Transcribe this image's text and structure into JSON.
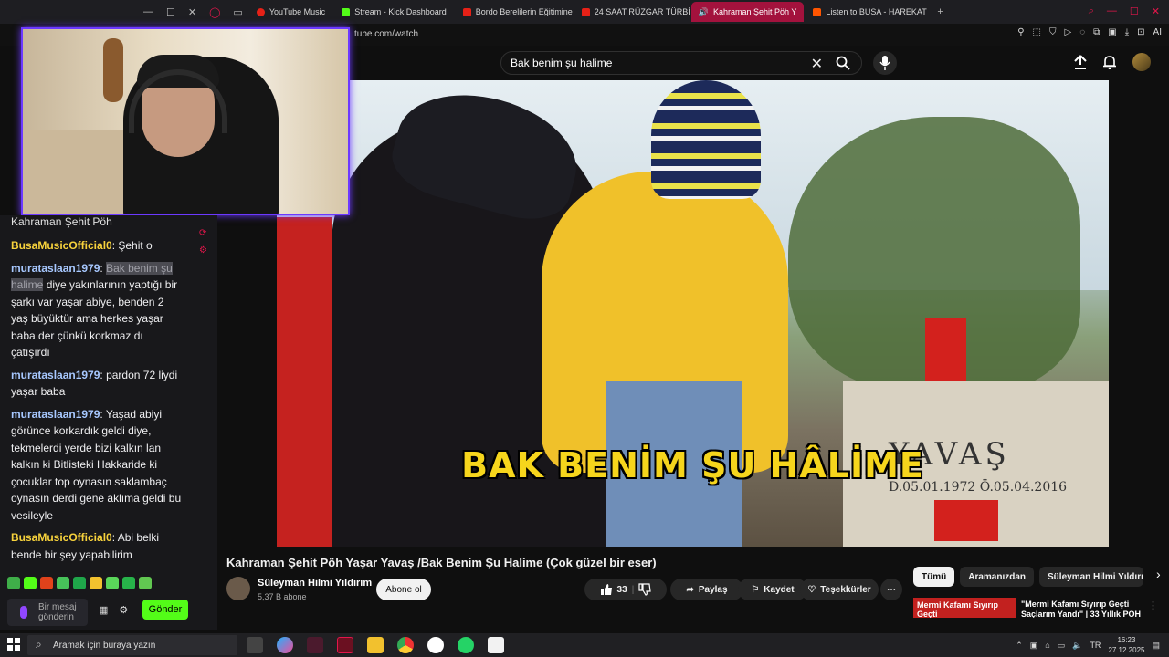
{
  "browser": {
    "tabs": [
      {
        "label": "YouTube Music",
        "color": "#e62117"
      },
      {
        "label": "Stream - Kick Dashboard",
        "color": "#53fc18"
      },
      {
        "label": "Bordo Berelilerin Eğitimine",
        "color": "#e62117"
      },
      {
        "label": "24 SAAT RÜZGAR TÜRBİN",
        "color": "#e62117"
      },
      {
        "label": "Kahraman Şehit Pöh Y",
        "color": "#e62117",
        "active": true
      },
      {
        "label": "Listen to BUSA - HAREKAT",
        "color": "#ff5500"
      }
    ],
    "url": "tube.com/watch",
    "ai_label": "AI"
  },
  "youtube": {
    "search_query": "Bak benim şu halime",
    "video_overlay_text": "BAK BENİM ŞU HÂLİME",
    "grave_name": "YAVAŞ",
    "grave_dates": "D.05.01.1972   Ö.05.04.2016",
    "video_title": "Kahraman Şehit Pöh Yaşar Yavaş /Bak Benim Şu Halime (Çok güzel bir eser)",
    "channel_name": "Süleyman Hilmi Yıldırım",
    "channel_subs": "5,37 B abone",
    "subscribe_label": "Abone ol",
    "like_count": "33",
    "share_label": "Paylaş",
    "save_label": "Kaydet",
    "thanks_label": "Teşekkürler",
    "chips": [
      "Tümü",
      "Aramanızdan",
      "Süleyman Hilmi Yıldırım"
    ],
    "rec_thumb_text": "Mermi Kafamı Sıyırıp Geçti",
    "rec_title": "\"Mermi Kafamı Sıyırıp Geçti Saçlarım Yandı\" | 33 Yıllık PÖH"
  },
  "chat": {
    "title": "Kahraman Şehit Pöh",
    "messages": [
      {
        "user": "BusaMusicOfficial0",
        "user_class": "u1",
        "text": "Şehit o"
      },
      {
        "user": "murataslaan1979",
        "user_class": "u2",
        "highlight": "Bak benim şu halime",
        "text": "diye yakınlarının yaptığı bir şarkı var yaşar abiye, benden 2 yaş büyüktür ama herkes yaşar baba der çünkü korkmaz dı çatışırdı"
      },
      {
        "user": "murataslaan1979",
        "user_class": "u2",
        "text": "pardon 72 liydi yaşar baba"
      },
      {
        "user": "murataslaan1979",
        "user_class": "u2",
        "text": "Yaşad abiyi görünce korkardık geldi diye, tekmelerdi yerde bizi kalkın lan kalkın ki Bitlisteki Hakkaride ki çocuklar top oynasın saklambaç oynasın derdi gene aklıma geldi bu vesileyle"
      },
      {
        "user": "BusaMusicOfficial0",
        "user_class": "u1",
        "text": "Abi belki bende bir şey yapabilirim"
      }
    ],
    "input_placeholder": "Bir mesaj gönderin",
    "send_label": "Gönder",
    "emote_colors": [
      "#3fae49",
      "#53fc18",
      "#e0421b",
      "#47c35a",
      "#1fa64a",
      "#f2c12e",
      "#5ad65a",
      "#27b34a",
      "#61c751"
    ]
  },
  "taskbar": {
    "search_placeholder": "Aramak için buraya yazın",
    "time": "16:23",
    "date": "27.12.2025"
  }
}
